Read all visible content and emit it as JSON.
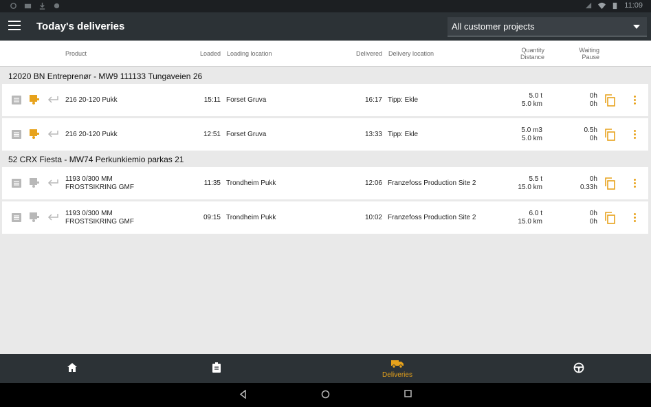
{
  "status_bar": {
    "time": "11:09"
  },
  "app_bar": {
    "title": "Today's deliveries",
    "project_filter": "All customer projects"
  },
  "columns": {
    "product": "Product",
    "loaded": "Loaded",
    "loading_location": "Loading location",
    "delivered": "Delivered",
    "delivery_location": "Delivery location",
    "quantity": "Quantity",
    "distance": "Distance",
    "waiting": "Waiting",
    "pause": "Pause"
  },
  "groups": [
    {
      "title": "12020 BN Entreprenør - MW9 111133 Tungaveien 26",
      "deliveries": [
        {
          "product_line1": "216 20-120 Pukk",
          "product_line2": "",
          "loaded": "15:11",
          "loading_location": "Forset Gruva",
          "delivered": "16:17",
          "delivery_location": "Tipp: Ekle",
          "quantity": "5.0 t",
          "distance": "5.0 km",
          "waiting": "0h",
          "pause": "0h",
          "active": true
        },
        {
          "product_line1": "216 20-120 Pukk",
          "product_line2": "",
          "loaded": "12:51",
          "loading_location": "Forset Gruva",
          "delivered": "13:33",
          "delivery_location": "Tipp: Ekle",
          "quantity": "5.0 m3",
          "distance": "5.0 km",
          "waiting": "0.5h",
          "pause": "0h",
          "active": true
        }
      ]
    },
    {
      "title": "52 CRX Fiesta - MW74 Perkunkiemio parkas 21",
      "deliveries": [
        {
          "product_line1": "1193 0/300 MM",
          "product_line2": "FROSTSIKRING GMF",
          "loaded": "11:35",
          "loading_location": "Trondheim Pukk",
          "delivered": "12:06",
          "delivery_location": "Franzefoss Production Site 2",
          "quantity": "5.5 t",
          "distance": "15.0 km",
          "waiting": "0h",
          "pause": "0.33h",
          "active": false
        },
        {
          "product_line1": "1193 0/300 MM",
          "product_line2": "FROSTSIKRING GMF",
          "loaded": "09:15",
          "loading_location": "Trondheim Pukk",
          "delivered": "10:02",
          "delivery_location": "Franzefoss Production Site 2",
          "quantity": "6.0 t",
          "distance": "15.0 km",
          "waiting": "0h",
          "pause": "0h",
          "active": false
        }
      ]
    }
  ],
  "bottom_nav": [
    {
      "icon": "home-icon",
      "label": ""
    },
    {
      "icon": "clipboard-icon",
      "label": ""
    },
    {
      "icon": "truck-icon",
      "label": "Deliveries",
      "active": true
    },
    {
      "icon": "steering-wheel-icon",
      "label": ""
    }
  ],
  "colors": {
    "accent": "#e7a21b",
    "bar": "#2c3236",
    "inactive_icon": "#b8b8b8"
  }
}
